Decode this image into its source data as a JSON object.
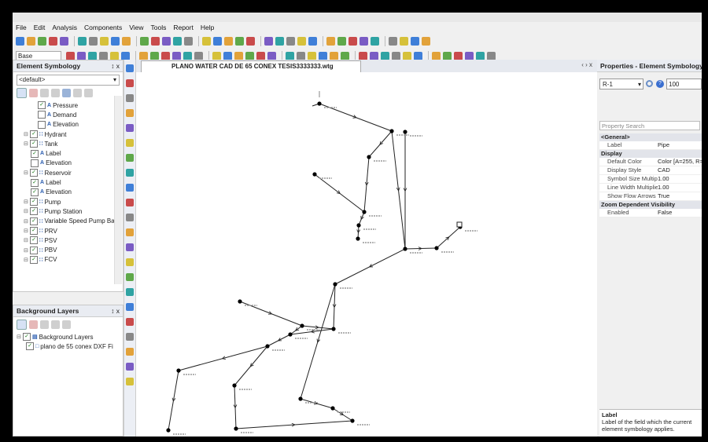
{
  "menu": [
    "File",
    "Edit",
    "Analysis",
    "Components",
    "View",
    "Tools",
    "Report",
    "Help"
  ],
  "toolbar": {
    "scenario_value": "Base"
  },
  "element_symbology": {
    "title": "Element Symbology",
    "pin": "↕ x",
    "selected": "<default>",
    "items": [
      {
        "label": "Pressure",
        "indent": 3,
        "checked": true,
        "field": true
      },
      {
        "label": "Demand",
        "indent": 3,
        "checked": false,
        "field": true
      },
      {
        "label": "Elevation",
        "indent": 3,
        "checked": false,
        "field": true
      },
      {
        "label": "Hydrant",
        "indent": 1,
        "checked": true,
        "field": false
      },
      {
        "label": "Tank",
        "indent": 1,
        "checked": true,
        "field": false
      },
      {
        "label": "Label",
        "indent": 2,
        "checked": true,
        "field": true
      },
      {
        "label": "Elevation",
        "indent": 2,
        "checked": false,
        "field": true
      },
      {
        "label": "Reservoir",
        "indent": 1,
        "checked": true,
        "field": false
      },
      {
        "label": "Label",
        "indent": 2,
        "checked": true,
        "field": true
      },
      {
        "label": "Elevation",
        "indent": 2,
        "checked": true,
        "field": true
      },
      {
        "label": "Pump",
        "indent": 1,
        "checked": true,
        "field": false
      },
      {
        "label": "Pump Station",
        "indent": 1,
        "checked": true,
        "field": false
      },
      {
        "label": "Variable Speed Pump Batt",
        "indent": 1,
        "checked": true,
        "field": false
      },
      {
        "label": "PRV",
        "indent": 1,
        "checked": true,
        "field": false
      },
      {
        "label": "PSV",
        "indent": 1,
        "checked": true,
        "field": false
      },
      {
        "label": "PBV",
        "indent": 1,
        "checked": true,
        "field": false
      },
      {
        "label": "FCV",
        "indent": 1,
        "checked": true,
        "field": false
      }
    ]
  },
  "background_layers": {
    "title": "Background Layers",
    "pin": "↕ x",
    "items": [
      {
        "label": "Background Layers",
        "indent": 0
      },
      {
        "label": "plano de 55 conex  DXF Fi",
        "indent": 1
      }
    ]
  },
  "document": {
    "tab_title": "PLANO WATER CAD DE 65 CONEX TESIS3333333.wtg",
    "tab_controls": "‹ › x"
  },
  "properties": {
    "title": "Properties - Element Symbology -",
    "selected": "R-1",
    "zoom_value": "100",
    "search_placeholder": "Property Search",
    "sections": [
      {
        "name": "<General>",
        "rows": [
          {
            "name": "Label",
            "value": "Pipe"
          }
        ]
      },
      {
        "name": "Display",
        "rows": [
          {
            "name": "Default Color",
            "value": "Color [A=255, R="
          },
          {
            "name": "Display Style",
            "value": "CAD"
          },
          {
            "name": "Symbol Size Multipl",
            "value": "1.00"
          },
          {
            "name": "Line Width Multiplier",
            "value": "1.00"
          },
          {
            "name": "Show Flow Arrows",
            "value": "True"
          }
        ]
      },
      {
        "name": "Zoom Dependent Visibility",
        "rows": [
          {
            "name": "Enabled",
            "value": "False"
          }
        ]
      }
    ],
    "help_title": "Label",
    "help_text": "Label of the field which the current element symbology applies."
  },
  "colors": {
    "panel_header": "#e9ecf2",
    "checkbox_green": "#1a7a1a",
    "field_icon_blue": "#2a5db0"
  }
}
